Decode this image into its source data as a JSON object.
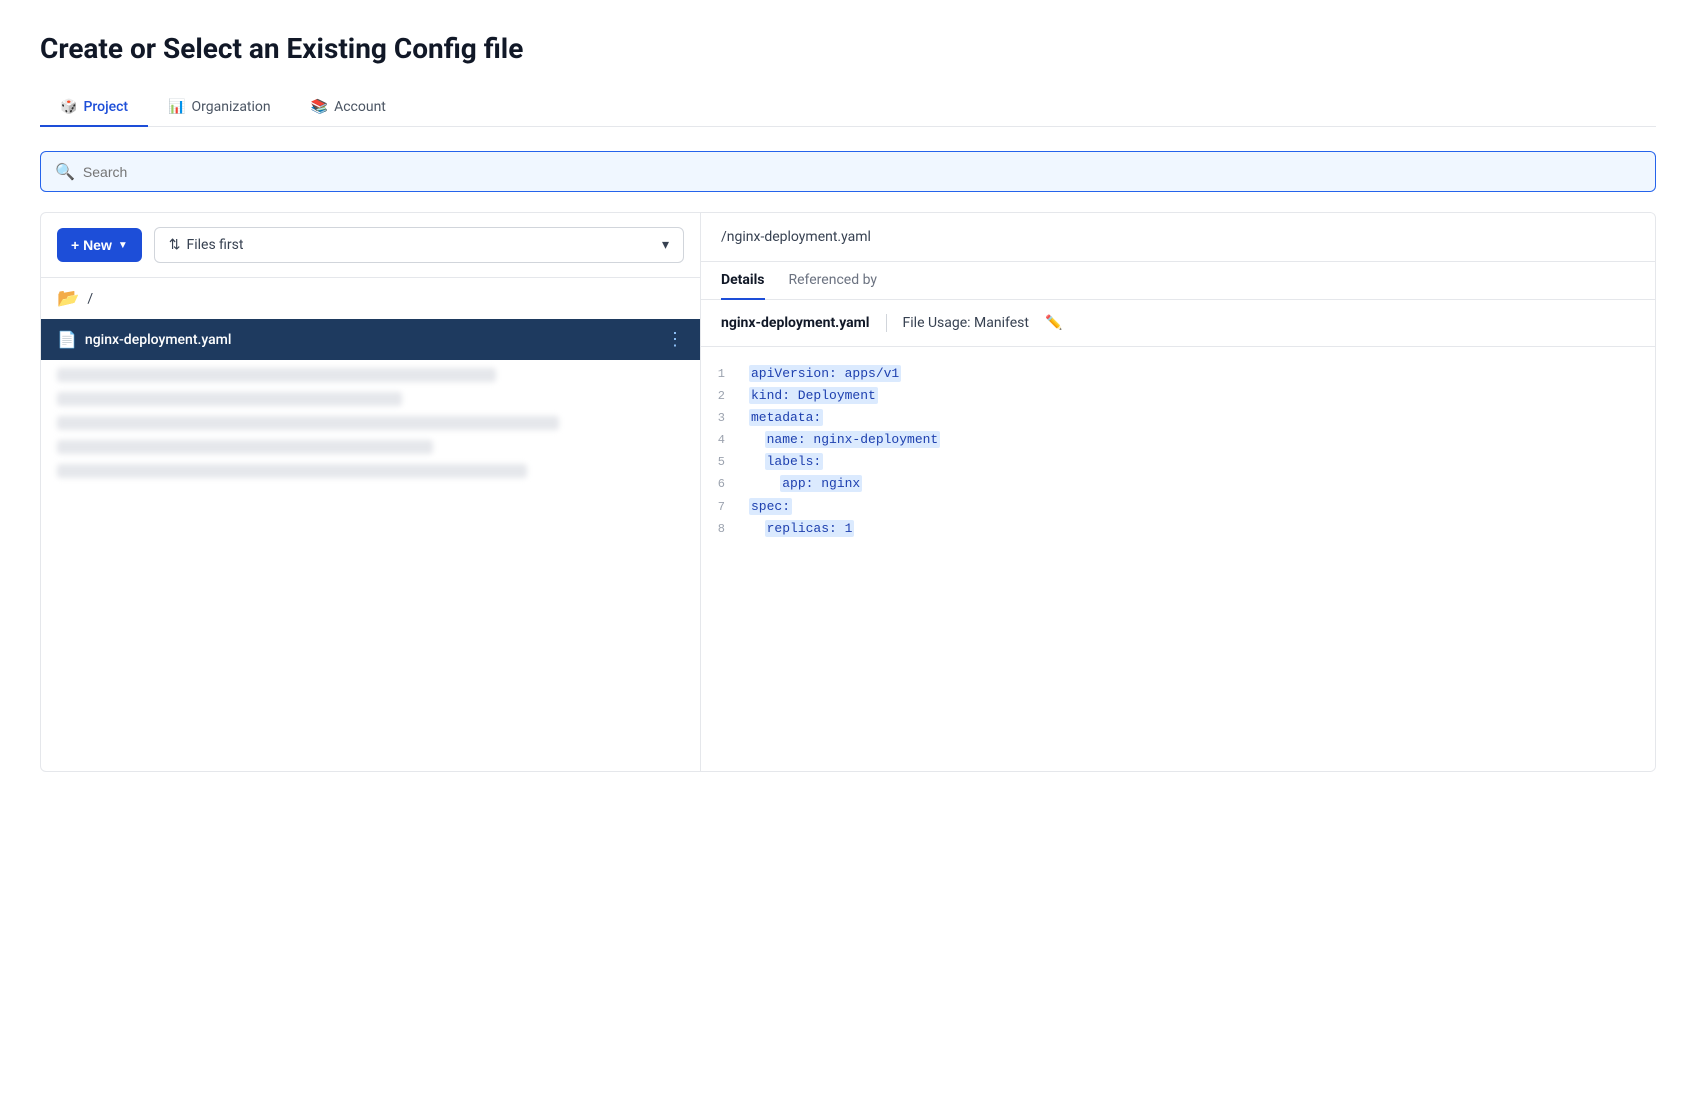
{
  "page": {
    "title": "Create or Select an Existing Config file"
  },
  "tabs": [
    {
      "id": "project",
      "label": "Project",
      "icon": "🎲",
      "active": true
    },
    {
      "id": "organization",
      "label": "Organization",
      "icon": "📊",
      "active": false
    },
    {
      "id": "account",
      "label": "Account",
      "icon": "📚",
      "active": false
    }
  ],
  "search": {
    "placeholder": "Search"
  },
  "file_panel": {
    "new_button": "+ New",
    "sort_label": "Files first",
    "folder_name": "/",
    "file_name": "nginx-deployment.yaml"
  },
  "detail_panel": {
    "path": "/nginx-deployment.yaml",
    "tabs": [
      {
        "id": "details",
        "label": "Details",
        "active": true
      },
      {
        "id": "referenced_by",
        "label": "Referenced by",
        "active": false
      }
    ],
    "file_name": "nginx-deployment.yaml",
    "file_usage_prefix": "File Usage:",
    "file_usage_type": "Manifest",
    "code_lines": [
      {
        "num": "1",
        "text": "apiVersion: apps/v1",
        "highlight": true
      },
      {
        "num": "2",
        "text": "kind: Deployment",
        "highlight": true
      },
      {
        "num": "3",
        "text": "metadata:",
        "highlight": true
      },
      {
        "num": "4",
        "text": "  name: nginx-deployment",
        "highlight": true
      },
      {
        "num": "5",
        "text": "  labels:",
        "highlight": true
      },
      {
        "num": "6",
        "text": "    app: nginx",
        "highlight": true
      },
      {
        "num": "7",
        "text": "spec:",
        "highlight": true
      },
      {
        "num": "8",
        "text": "  replicas: 1",
        "highlight": true
      }
    ]
  }
}
